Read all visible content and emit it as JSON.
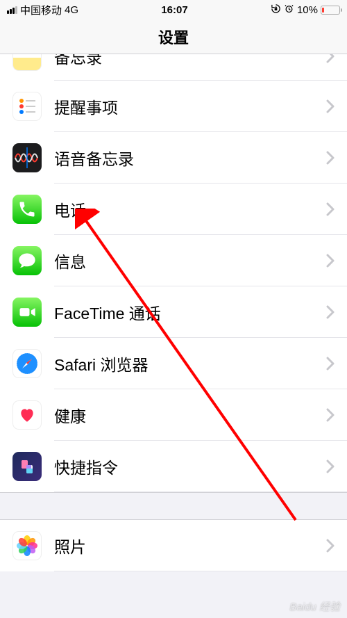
{
  "status": {
    "carrier": "中国移动",
    "network": "4G",
    "time": "16:07",
    "battery_pct": "10%"
  },
  "nav": {
    "title": "设置"
  },
  "rows": {
    "notes": "备忘录",
    "reminders": "提醒事项",
    "voicememos": "语音备忘录",
    "phone": "电话",
    "messages": "信息",
    "facetime": "FaceTime 通话",
    "safari": "Safari 浏览器",
    "health": "健康",
    "shortcuts": "快捷指令",
    "photos": "照片"
  },
  "watermark": "Baidu 经验"
}
